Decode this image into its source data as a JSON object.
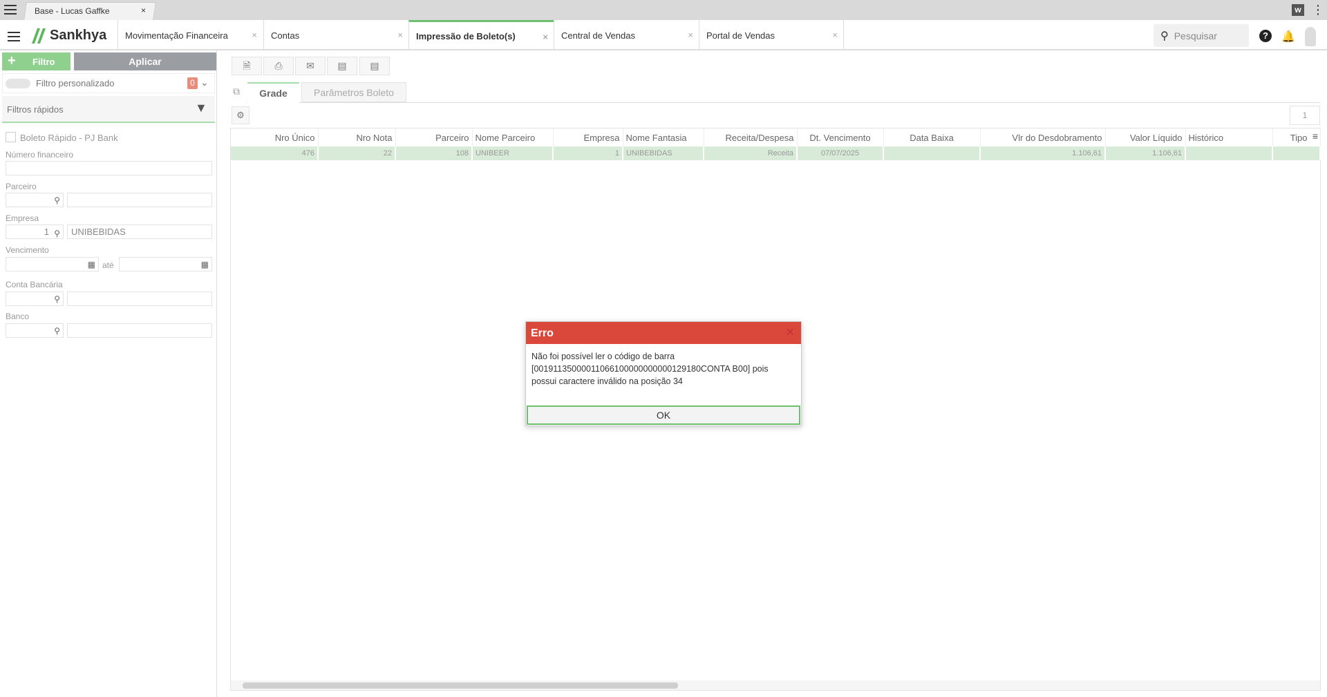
{
  "browser": {
    "tab_title": "Base - Lucas Gaffke",
    "close": "×"
  },
  "app": {
    "logo": "Sankhya",
    "search_placeholder": "Pesquisar",
    "tabs": [
      {
        "label": "Movimentação Financeira"
      },
      {
        "label": "Contas"
      },
      {
        "label": "Impressão de Boleto(s)",
        "active": true
      },
      {
        "label": "Central de Vendas"
      },
      {
        "label": "Portal de Vendas"
      }
    ]
  },
  "filter": {
    "filtro_label": "Filtro",
    "aplicar_label": "Aplicar",
    "custom_label": "Filtro personalizado",
    "custom_count": "0",
    "quick_label": "Filtros rápidos",
    "boleto_rapido": "Boleto Rápido - PJ Bank",
    "numero_financeiro": "Número financeiro",
    "parceiro": "Parceiro",
    "empresa": "Empresa",
    "empresa_code": "1",
    "empresa_name": "UNIBEBIDAS",
    "vencimento": "Vencimento",
    "ate": "até",
    "conta_bancaria": "Conta Bancária",
    "banco": "Banco"
  },
  "main": {
    "tabs": [
      "Grade",
      "Parâmetros Boleto"
    ],
    "page": "1",
    "columns": [
      "Nro Único",
      "Nro Nota",
      "Parceiro",
      "Nome Parceiro",
      "Empresa",
      "Nome Fantasia",
      "Receita/Despesa",
      "Dt. Vencimento",
      "Data Baixa",
      "Vlr do Desdobramento",
      "Valor Líquido",
      "Histórico",
      "Tipo"
    ],
    "rows": [
      [
        "476",
        "22",
        "108",
        "UNIBEER",
        "1",
        "UNIBEBIDAS",
        "Receita",
        "07/07/2025",
        "",
        "1.106,61",
        "1.106,61",
        "",
        ""
      ]
    ]
  },
  "dialog": {
    "title": "Erro",
    "message": "Não foi possível ler o código de barra [00191135000011066100000000000129180CONTA B00] pois possui caractere inválido na posição 34",
    "ok": "OK"
  },
  "colors": {
    "accent": "#6cc070",
    "error": "#d9483b"
  }
}
